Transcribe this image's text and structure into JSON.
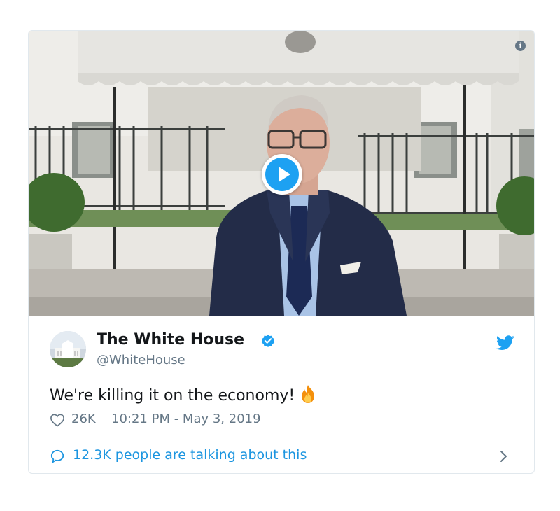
{
  "tweet": {
    "display_name": "The White House",
    "handle": "@WhiteHouse",
    "text": "We're killing it on the economy!",
    "likes": "26K",
    "timestamp": "10:21 PM - May 3, 2019",
    "talking": "12.3K people are talking about this"
  },
  "icons": {
    "info": "info-icon",
    "play": "play-icon",
    "verified": "verified-badge-icon",
    "brand": "twitter-bird-icon",
    "emoji": "fire-emoji-icon",
    "like": "heart-icon",
    "reply": "comment-bubble-icon",
    "more": "chevron-right-icon"
  },
  "colors": {
    "accent": "#1da1f2",
    "link": "#1b95e0",
    "text": "#14171a",
    "muted": "#657786",
    "border": "#e1e8ed"
  }
}
